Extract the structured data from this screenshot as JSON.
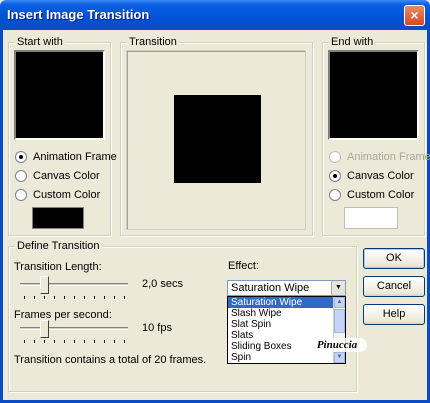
{
  "window": {
    "title": "Insert Image Transition",
    "close_glyph": "×"
  },
  "start_with": {
    "label": "Start with",
    "options": [
      "Animation Frame",
      "Canvas Color",
      "Custom Color"
    ],
    "selected": 0,
    "swatch_color": "#000000"
  },
  "transition": {
    "label": "Transition"
  },
  "end_with": {
    "label": "End with",
    "options": [
      "Animation Frame",
      "Canvas Color",
      "Custom Color"
    ],
    "selected": 1,
    "disabled_option": 0,
    "swatch_color": "#ffffff"
  },
  "define": {
    "label": "Define Transition",
    "length_label": "Transition Length:",
    "length_value": "2,0 secs",
    "length_level": 0.2,
    "fps_label": "Frames per second:",
    "fps_value": "10 fps",
    "fps_level": 0.2,
    "summary": "Transition contains a total of 20 frames.",
    "effect_label": "Effect:",
    "effect_selected": "Saturation Wipe",
    "effect_options": [
      "Saturation Wipe",
      "Slash Wipe",
      "Slat Spin",
      "Slats",
      "Sliding Boxes",
      "Spin"
    ]
  },
  "buttons": {
    "ok": "OK",
    "cancel": "Cancel",
    "help": "Help"
  },
  "watermark": "Pinuccia",
  "colors": {
    "titlebar": "#0052d6",
    "selection": "#316ac5",
    "dialog_bg": "#ece9d8"
  }
}
